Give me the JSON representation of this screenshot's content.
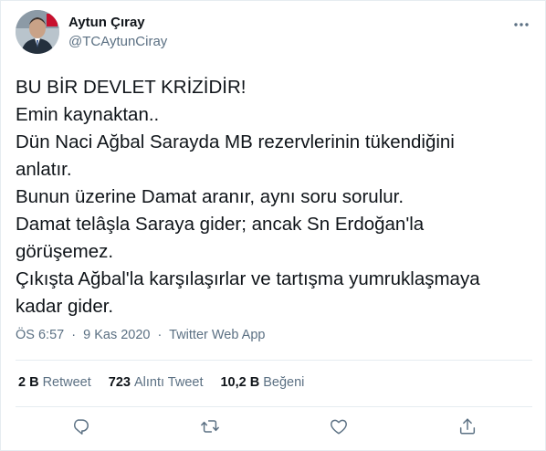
{
  "user": {
    "name": "Aytun Çıray",
    "handle": "@TCAytunCiray",
    "avatar_icon": "profile-photo"
  },
  "tweet": {
    "lines": [
      "BU BİR DEVLET KRİZİDİR!",
      "Emin kaynaktan..",
      "Dün Naci Ağbal Sarayda MB rezervlerinin tükendiğini",
      "anlatır.",
      "Bunun üzerine Damat aranır, aynı soru sorulur.",
      "Damat telâşla Saraya gider; ancak Sn Erdoğan'la",
      "görüşemez.",
      "Çıkışta Ağbal'la karşılaşırlar ve tartışma yumruklaşmaya",
      "kadar gider."
    ]
  },
  "meta": {
    "time": "ÖS 6:57",
    "separator": "·",
    "date": "9 Kas 2020",
    "app": "Twitter Web App"
  },
  "stats": {
    "retweets_count": "2 B",
    "retweets_label": "Retweet",
    "quotes_count": "723",
    "quotes_label": "Alıntı Tweet",
    "likes_count": "10,2 B",
    "likes_label": "Beğeni"
  },
  "icons": {
    "more": "more-horizontal-icon",
    "reply": "reply-icon",
    "retweet": "retweet-icon",
    "like": "heart-icon",
    "share": "share-icon"
  },
  "colors": {
    "text": "#0f1419",
    "secondary": "#5b7083",
    "border": "#e6ecf0"
  }
}
